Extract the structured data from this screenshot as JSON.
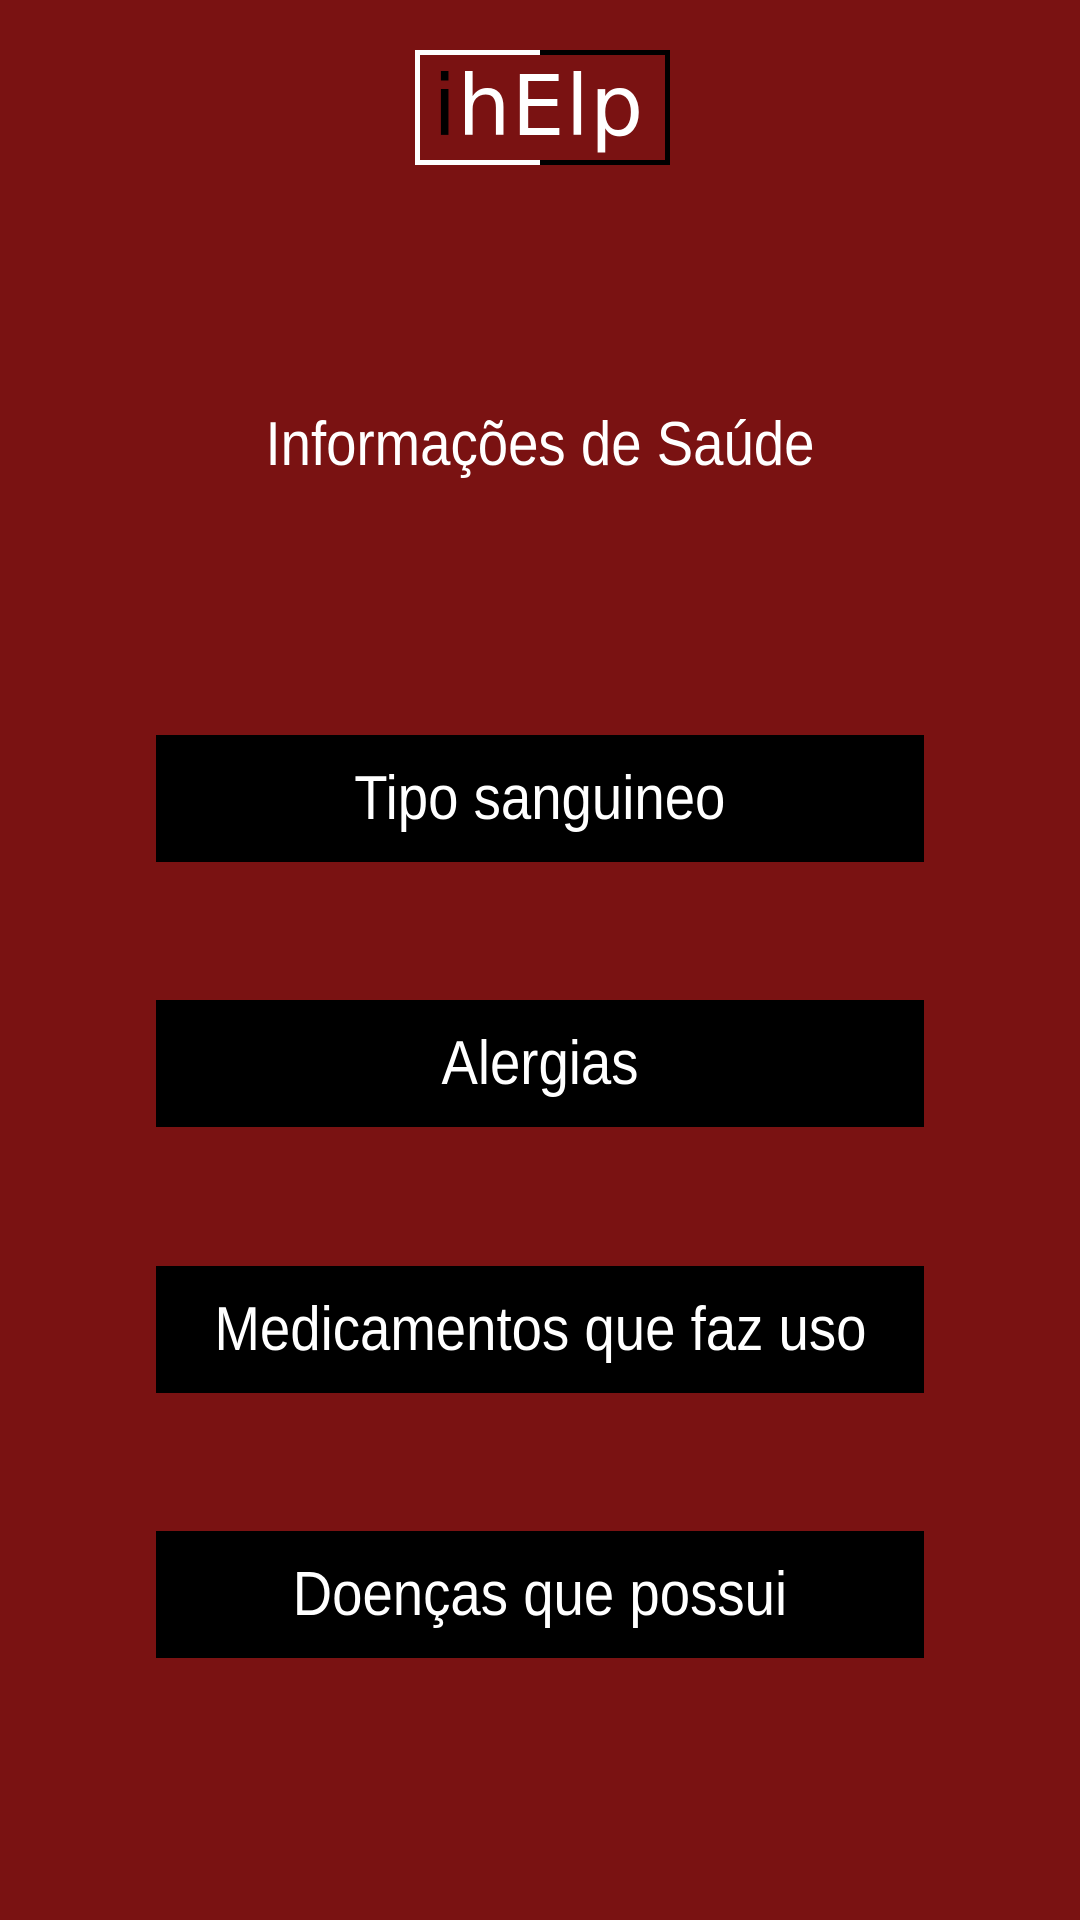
{
  "logo": {
    "part_i": "i",
    "part_h": "h",
    "part_rest": "Elp"
  },
  "title": "Informações de Saúde",
  "buttons": [
    {
      "label": "Tipo sanguineo"
    },
    {
      "label": "Alergias"
    },
    {
      "label": "Medicamentos que faz uso"
    },
    {
      "label": "Doenças que possui"
    }
  ],
  "colors": {
    "background": "#7a1212",
    "button_bg": "#000000",
    "text": "#ffffff"
  }
}
